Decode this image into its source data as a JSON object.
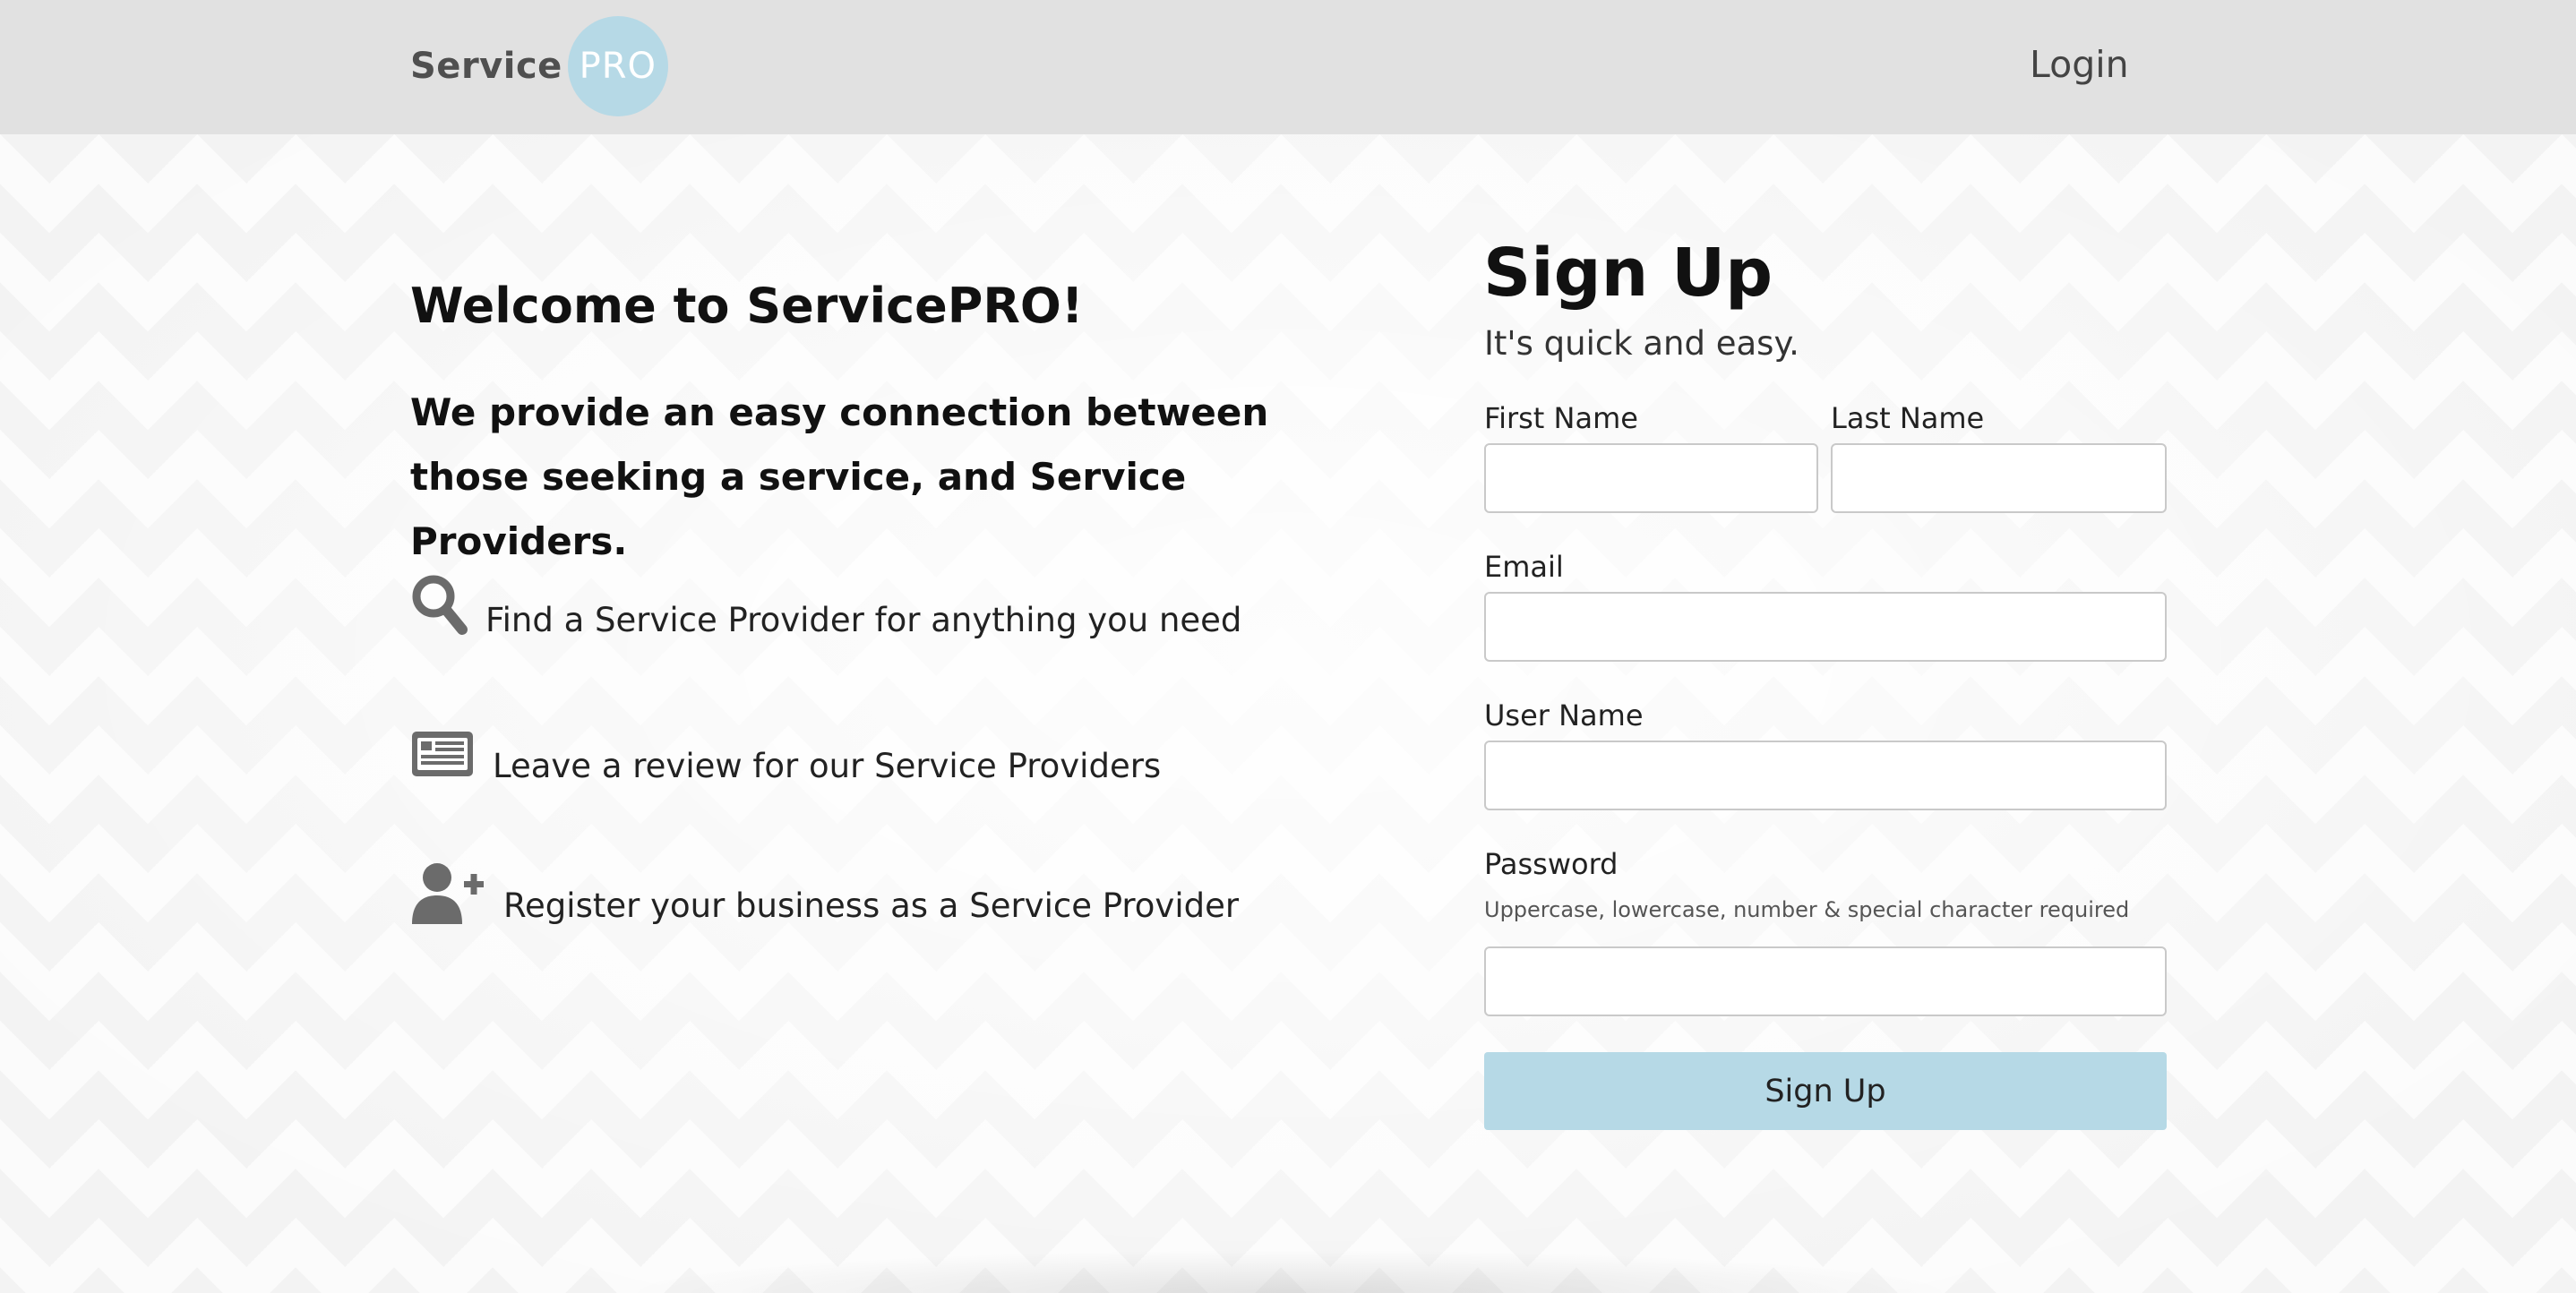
{
  "header": {
    "logo_service": "Service",
    "logo_pro": "PRO",
    "login_label": "Login"
  },
  "intro": {
    "title": "Welcome to ServicePRO!",
    "tagline": "We provide an easy connection between those seeking a service, and Service Providers."
  },
  "features": [
    {
      "icon": "search-icon",
      "text": "Find a Service Provider for anything you need"
    },
    {
      "icon": "newspaper-icon",
      "text": "Leave a review for our Service Providers"
    },
    {
      "icon": "user-plus-icon",
      "text": "Register your business as a Service Provider"
    }
  ],
  "signup": {
    "title": "Sign Up",
    "subtitle": "It's quick and easy.",
    "first_name_label": "First Name",
    "first_name_value": "",
    "last_name_label": "Last Name",
    "last_name_value": "",
    "email_label": "Email",
    "email_value": "",
    "username_label": "User Name",
    "username_value": "",
    "password_label": "Password",
    "password_help": "Uppercase, lowercase, number & special character required",
    "password_value": "",
    "button_label": "Sign Up"
  },
  "colors": {
    "header_bg": "#e1e1e1",
    "accent": "#b6d9e6",
    "icon": "#6b6b6b"
  }
}
